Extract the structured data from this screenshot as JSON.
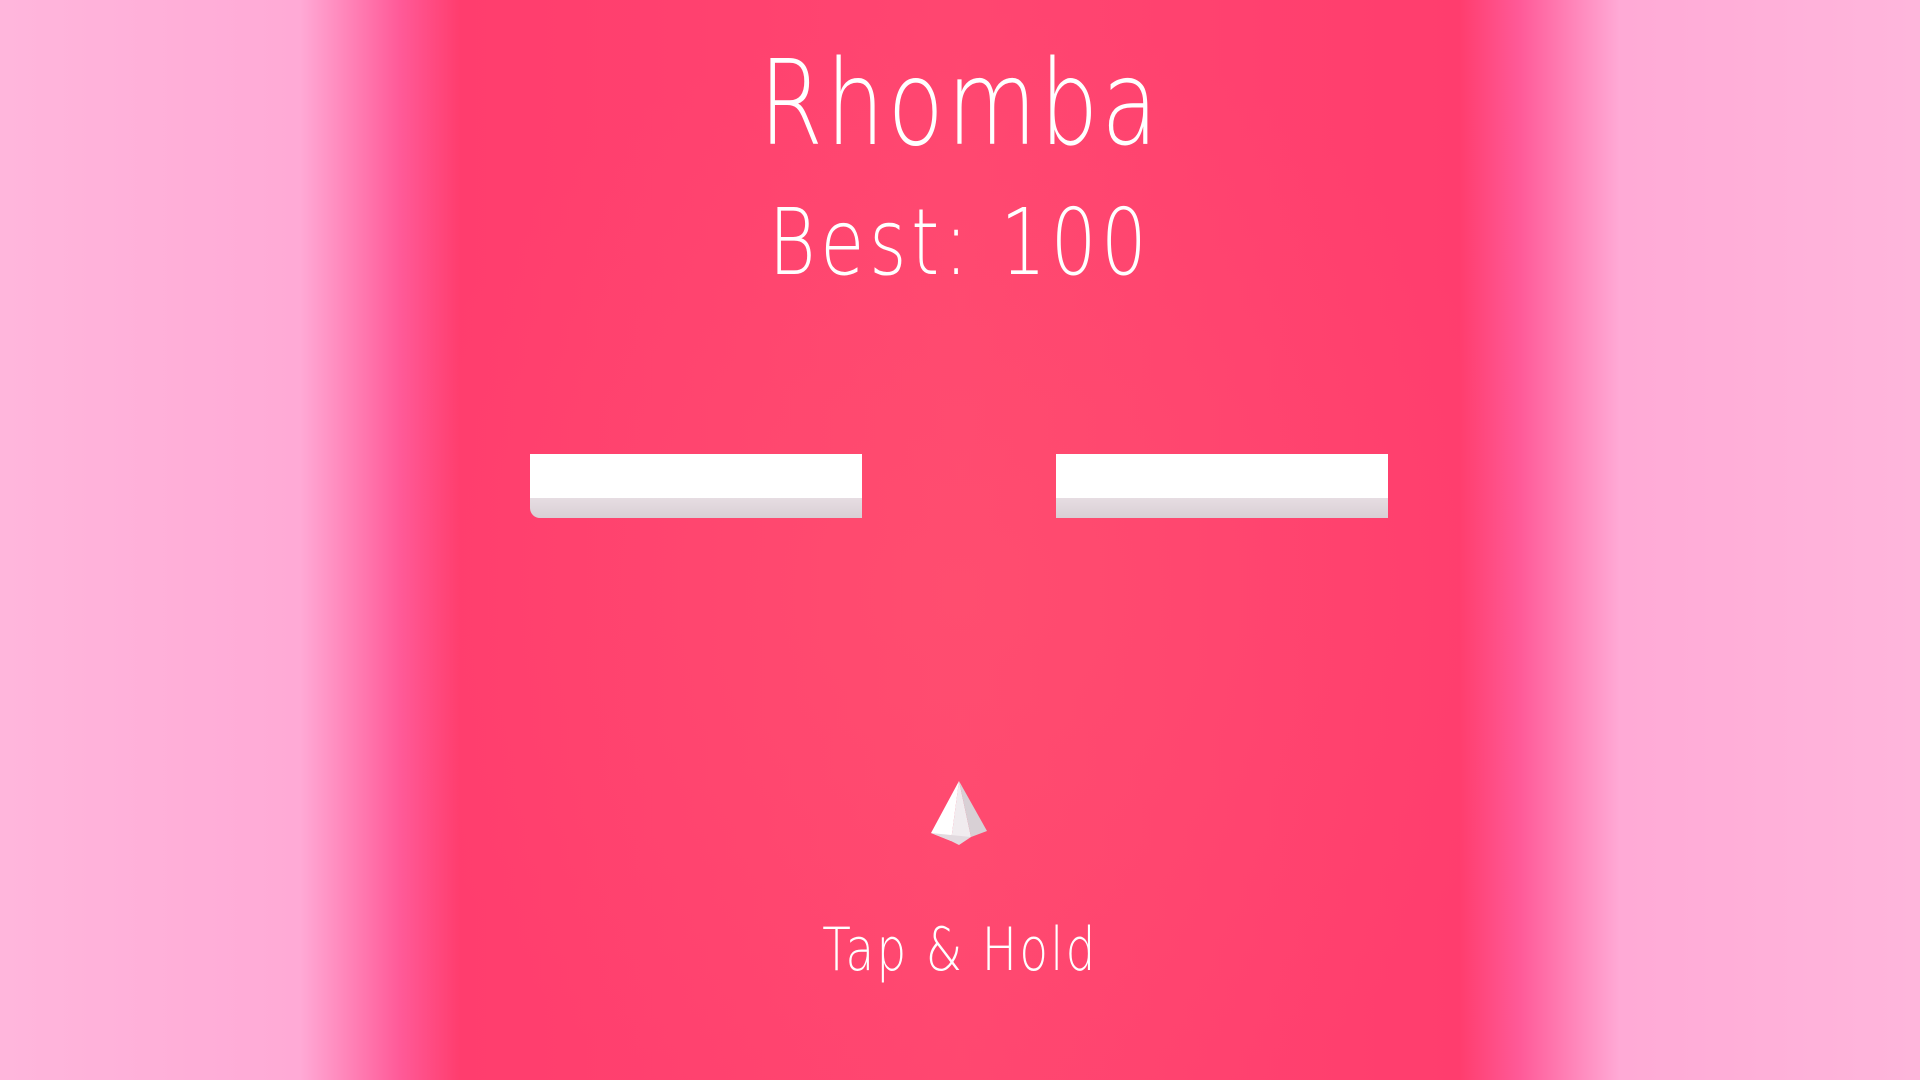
{
  "game": {
    "title": "Rhomba",
    "best_label": "Best:",
    "best_score": "100",
    "prompt": "Tap & Hold"
  },
  "colors": {
    "background_center": "#ff4670",
    "background_edges": "#ffb6dc",
    "obstacle": "#ffffff",
    "obstacle_side": "#ddd3d8",
    "text": "#ffffff"
  },
  "icons": {
    "player": "pyramid-icon"
  }
}
